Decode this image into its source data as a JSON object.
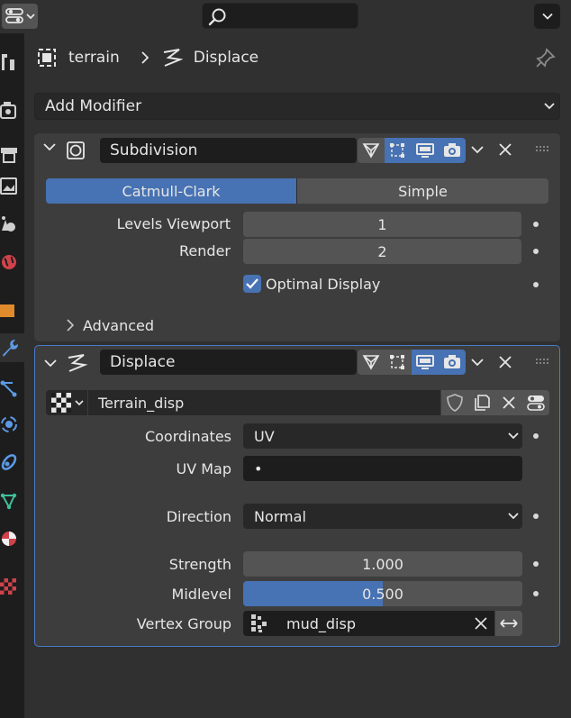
{
  "header": {
    "editor_type_icon": "properties-editor-icon",
    "search_icon": "search-icon"
  },
  "sidebar": {
    "tabs": [
      {
        "name": "tool",
        "icon": "wrench-screwdriver-icon"
      },
      {
        "name": "render",
        "icon": "camera-back-icon"
      },
      {
        "name": "output",
        "icon": "printer-icon"
      },
      {
        "name": "view-layer",
        "icon": "image-icon"
      },
      {
        "name": "scene",
        "icon": "scene-icon"
      },
      {
        "name": "world",
        "icon": "world-icon"
      },
      {
        "name": "object",
        "icon": "object-square-icon"
      },
      {
        "name": "modifiers",
        "icon": "wrench-icon",
        "active": true
      },
      {
        "name": "particles",
        "icon": "particles-icon"
      },
      {
        "name": "physics",
        "icon": "physics-icon"
      },
      {
        "name": "constraints",
        "icon": "constraints-icon"
      },
      {
        "name": "data",
        "icon": "mesh-data-icon"
      },
      {
        "name": "material",
        "icon": "material-icon"
      },
      {
        "name": "texture",
        "icon": "texture-icon"
      }
    ]
  },
  "breadcrumb": {
    "object": "terrain",
    "modifier": "Displace"
  },
  "add_modifier": {
    "label": "Add Modifier"
  },
  "subdivision": {
    "name": "Subdivision",
    "algorithms": [
      "Catmull-Clark",
      "Simple"
    ],
    "selected_algorithm": "Catmull-Clark",
    "levels_viewport_label": "Levels Viewport",
    "levels_viewport": "1",
    "render_label": "Render",
    "render": "2",
    "optimal_display_label": "Optimal Display",
    "optimal_display_checked": true,
    "advanced_label": "Advanced"
  },
  "displace": {
    "name": "Displace",
    "texture_name": "Terrain_disp",
    "coordinates_label": "Coordinates",
    "coordinates": "UV",
    "uv_map_label": "UV Map",
    "uv_map": "•",
    "direction_label": "Direction",
    "direction": "Normal",
    "strength_label": "Strength",
    "strength": "1.000",
    "midlevel_label": "Midlevel",
    "midlevel": "0.500",
    "midlevel_fraction": 0.5,
    "vertex_group_label": "Vertex Group",
    "vertex_group": "mud_disp"
  },
  "colors": {
    "accent": "#4772b3",
    "active_outline": "#4a7bc7",
    "panel": "#3d3d3d",
    "background": "#303030",
    "field": "#545454",
    "field_dark": "#1d1d1d"
  }
}
